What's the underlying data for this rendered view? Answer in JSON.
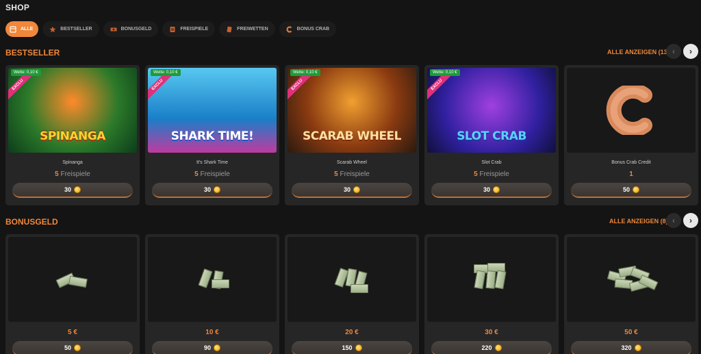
{
  "page_title": "SHOP",
  "filters": [
    {
      "label": "ALLE",
      "icon": "shop-icon",
      "active": true
    },
    {
      "label": "BESTSELLER",
      "icon": "star-icon",
      "active": false
    },
    {
      "label": "BONUSGELD",
      "icon": "money-icon",
      "active": false
    },
    {
      "label": "FREISPIELE",
      "icon": "ticket-icon",
      "active": false
    },
    {
      "label": "FREIWETTEN",
      "icon": "bet-icon",
      "active": false
    },
    {
      "label": "BONUS CRAB",
      "icon": "crab-icon",
      "active": false
    }
  ],
  "bestseller": {
    "title": "BESTSELLER",
    "show_all": "ALLE ANZEIGEN (13)",
    "items": [
      {
        "name": "Spinanga",
        "badge": "Wette: 0,10 €",
        "ribbon": "EXCLU",
        "game_title": "SPINANGA",
        "value": "5",
        "unit": "Freispiele",
        "price": "30"
      },
      {
        "name": "It's Shark Time",
        "badge": "Wette: 0,10 €",
        "ribbon": "EXCLU",
        "game_title": "SHARK TIME!",
        "value": "5",
        "unit": "Freispiele",
        "price": "30"
      },
      {
        "name": "Scarab Wheel",
        "badge": "Wette: 0,10 €",
        "ribbon": "EXCLU",
        "game_title": "SCARAB WHEEL",
        "value": "5",
        "unit": "Freispiele",
        "price": "30"
      },
      {
        "name": "Slot Crab",
        "badge": "Wette: 0,10 €",
        "ribbon": "EXCLU",
        "game_title": "SLOT CRAB",
        "value": "5",
        "unit": "Freispiele",
        "price": "30"
      },
      {
        "name": "Bonus Crab Credit",
        "value": "1",
        "unit": "",
        "price": "50"
      }
    ]
  },
  "bonusgeld": {
    "title": "BONUSGELD",
    "show_all": "ALLE ANZEIGEN (8)",
    "items": [
      {
        "amount": "5 €",
        "price": "50"
      },
      {
        "amount": "10 €",
        "price": "90"
      },
      {
        "amount": "20 €",
        "price": "150"
      },
      {
        "amount": "30 €",
        "price": "220"
      },
      {
        "amount": "50 €",
        "price": "320"
      }
    ]
  },
  "colors": {
    "accent": "#f0873a",
    "background": "#141414",
    "card": "#262626"
  }
}
